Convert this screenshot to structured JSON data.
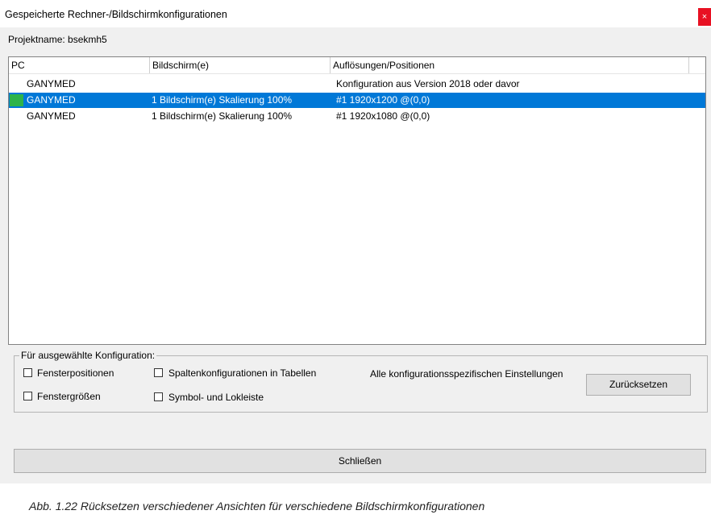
{
  "window": {
    "title": "Gespeicherte Rechner-/Bildschirmkonfigurationen",
    "close_glyph": "×"
  },
  "project": {
    "label": "Projektname: bsekmh5"
  },
  "table": {
    "columns": [
      "PC",
      "Bildschirm(e)",
      "Auflösungen/Positionen"
    ],
    "rows": [
      {
        "pc": "GANYMED",
        "screens": "",
        "resolution": "Konfiguration aus Version 2018 oder davor",
        "selected": false
      },
      {
        "pc": "GANYMED",
        "screens": "1 Bildschirm(e) Skalierung 100%",
        "resolution": "#1 1920x1200 @(0,0)",
        "selected": true
      },
      {
        "pc": "GANYMED",
        "screens": "1 Bildschirm(e) Skalierung 100%",
        "resolution": "#1 1920x1080 @(0,0)",
        "selected": false
      }
    ]
  },
  "group": {
    "legend": "Für ausgewählte Konfiguration:",
    "checkboxes": {
      "window_positions": "Fensterpositionen",
      "window_sizes": "Fenstergrößen",
      "column_configs": "Spaltenkonfigurationen in Tabellen",
      "symbol_bar": "Symbol- und Lokleiste"
    },
    "all_settings": "Alle konfigurationsspezifischen Einstellungen",
    "reset_button": "Zurücksetzen"
  },
  "close_button": "Schließen",
  "caption": "Abb. 1.22    Rücksetzen verschiedener Ansichten für verschiedene Bildschirmkonfigurationen",
  "colors": {
    "selection": "#0078d7",
    "row_marker": "#2db34a",
    "close": "#e81123"
  }
}
